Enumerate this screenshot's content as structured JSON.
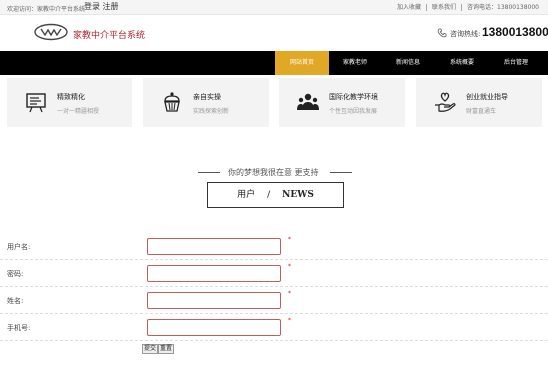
{
  "topbar": {
    "welcome": "欢迎访问：家教中介平台系统",
    "login": "登录 注册",
    "links": [
      "加入收藏",
      "联系我们",
      "咨询电话：13800138000"
    ]
  },
  "header": {
    "site_name": "家教中介平台系统",
    "hotline_label": "咨询热线:",
    "hotline_number": "13800138000"
  },
  "nav": {
    "items": [
      "网站首页",
      "家教老师",
      "新闻信息",
      "系统概要",
      "后台管理"
    ],
    "active_index": 0
  },
  "features": [
    {
      "title": "精致精化",
      "desc": "一对一精疆相授",
      "icon": "presentation-board-icon"
    },
    {
      "title": "亲自实操",
      "desc": "实践探索创新",
      "icon": "cupcake-icon"
    },
    {
      "title": "国际化教学环境",
      "desc": "个性互动因我发展",
      "icon": "group-people-icon"
    },
    {
      "title": "创业就业指导",
      "desc": "财富直通车",
      "icon": "hand-heart-icon"
    }
  ],
  "slogan": "你的梦想我很在意 更支持",
  "section_tag": {
    "cn": "用户",
    "sep": "/",
    "en": "NEWS"
  },
  "form": {
    "fields": [
      {
        "label": "用户名:",
        "value": "",
        "required": "*"
      },
      {
        "label": "密码:",
        "value": "",
        "required": "*"
      },
      {
        "label": "姓名:",
        "value": "",
        "required": "*"
      },
      {
        "label": "手机号:",
        "value": "",
        "required": "*"
      }
    ],
    "submit": "提交",
    "reset": "重置"
  },
  "colors": {
    "accent": "#e0a824",
    "brand_red": "#b3262c",
    "nav_bg": "#000000"
  }
}
